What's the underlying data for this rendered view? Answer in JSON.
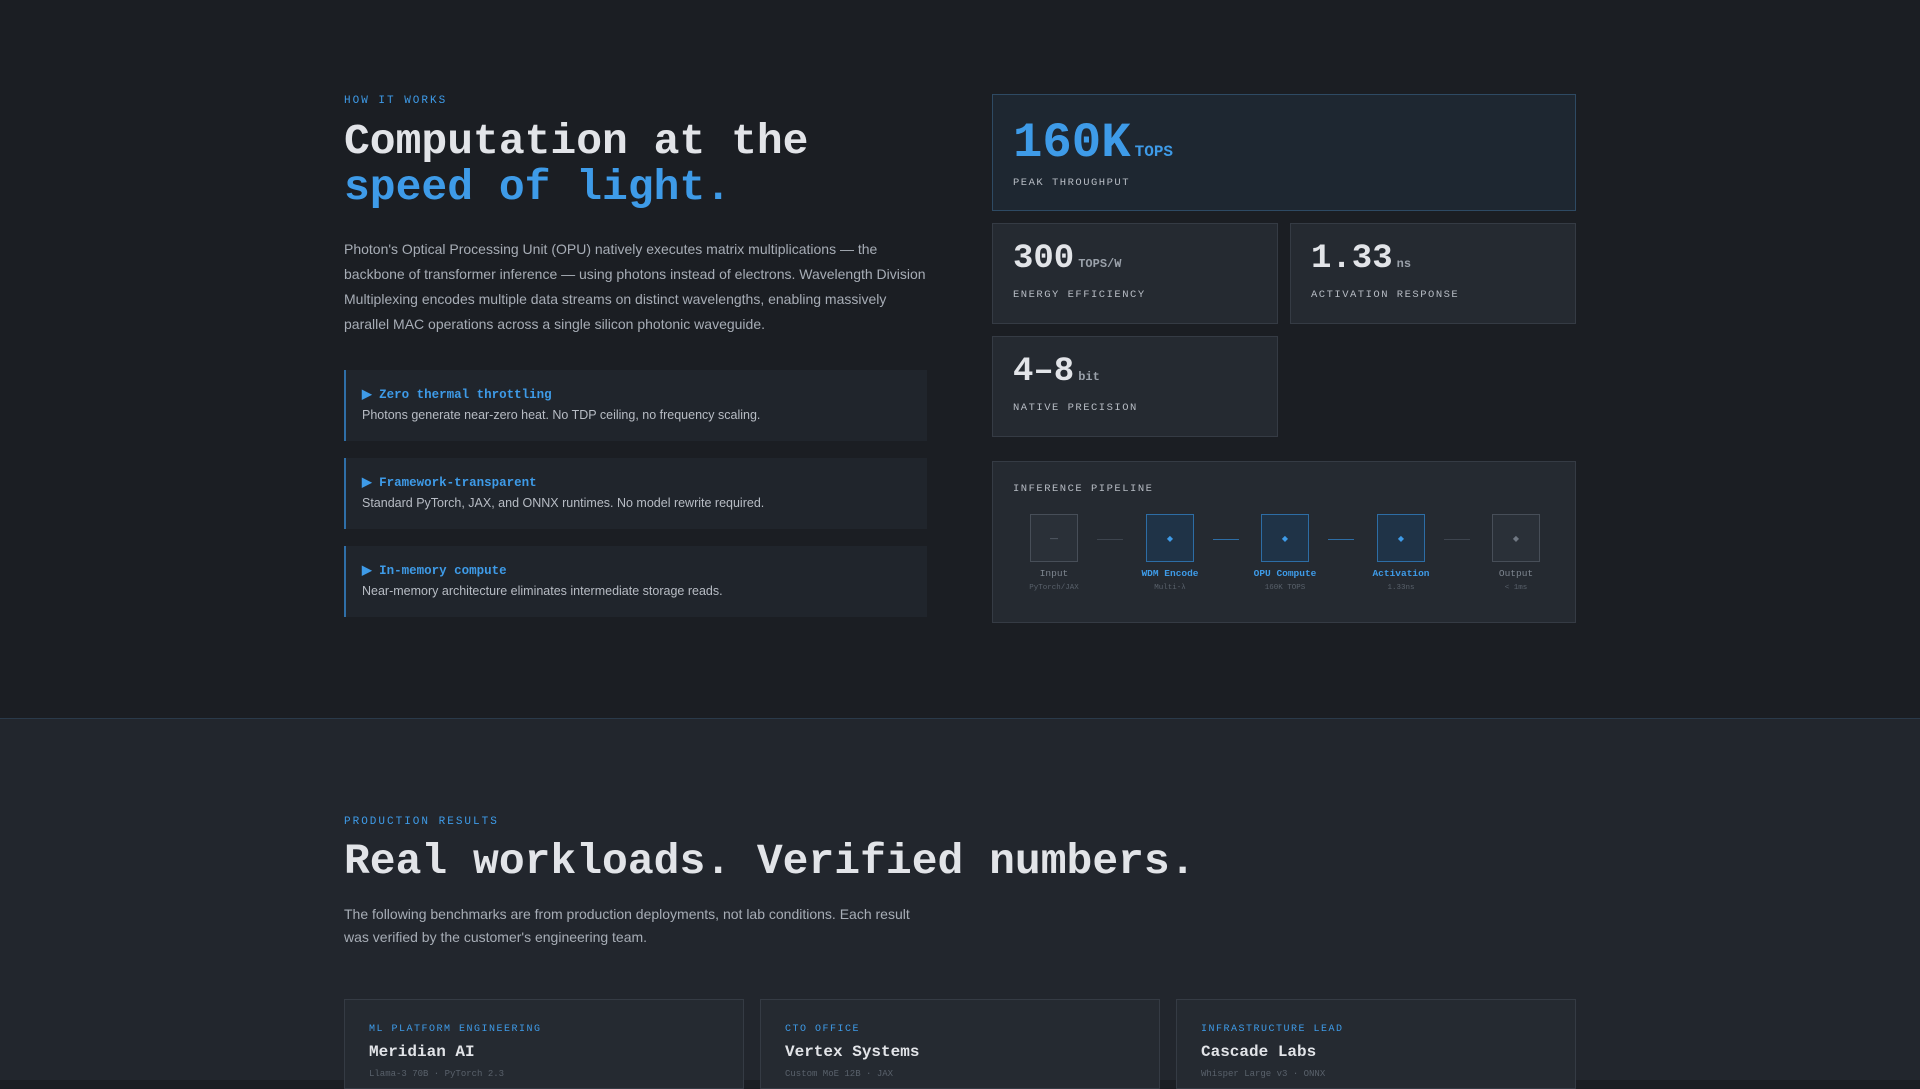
{
  "how": {
    "eyebrow": "HOW IT WORKS",
    "title_line1": "Computation at the",
    "title_line2": "speed of light.",
    "lead": "Photon's Optical Processing Unit (OPU) natively executes matrix multiplications — the backbone of transformer inference — using photons instead of electrons. Wavelength Division Multiplexing encodes multiple data streams on distinct wavelengths, enabling massively parallel MAC operations across a single silicon photonic waveguide.",
    "features": [
      {
        "title": "▶ Zero thermal throttling",
        "desc": "Photons generate near-zero heat. No TDP ceiling, no frequency scaling."
      },
      {
        "title": "▶ Framework-transparent",
        "desc": "Standard PyTorch, JAX, and ONNX runtimes. No model rewrite required."
      },
      {
        "title": "▶ In-memory compute",
        "desc": "Near-memory architecture eliminates intermediate storage reads."
      }
    ]
  },
  "stats": {
    "peak": {
      "value": "160K",
      "unit": "TOPS",
      "label": "PEAK THROUGHPUT"
    },
    "efficiency": {
      "value": "300",
      "unit": "TOPS/W",
      "label": "ENERGY EFFICIENCY"
    },
    "activation": {
      "value": "1.33",
      "unit": "ns",
      "label": "ACTIVATION RESPONSE"
    },
    "precision": {
      "value": "4–8",
      "unit": "bit",
      "label": "NATIVE PRECISION"
    }
  },
  "pipeline": {
    "title": "INFERENCE PIPELINE",
    "nodes": [
      {
        "glyph": "—",
        "label": "Input",
        "sub": "PyTorch/JAX"
      },
      {
        "glyph": "◆",
        "label": "WDM Encode",
        "sub": "Multi-λ"
      },
      {
        "glyph": "◆",
        "label": "OPU Compute",
        "sub": "160K TOPS"
      },
      {
        "glyph": "◆",
        "label": "Activation",
        "sub": "1.33ns"
      },
      {
        "glyph": "◆",
        "label": "Output",
        "sub": "< 1ms"
      }
    ]
  },
  "results": {
    "eyebrow": "PRODUCTION RESULTS",
    "title": "Real workloads. Verified numbers.",
    "lead_line1": "The following benchmarks are from production deployments, not lab conditions. Each result",
    "lead_line2": "was verified by the customer's engineering team.",
    "cards": [
      {
        "role": "ML PLATFORM ENGINEERING",
        "company": "Meridian AI",
        "meta": "Llama-3 70B · PyTorch 2.3"
      },
      {
        "role": "CTO OFFICE",
        "company": "Vertex Systems",
        "meta": "Custom MoE 12B · JAX"
      },
      {
        "role": "INFRASTRUCTURE LEAD",
        "company": "Cascade Labs",
        "meta": "Whisper Large v3 · ONNX"
      }
    ]
  },
  "colors": {
    "accent": "#3e9be8",
    "background": "#1b1e23",
    "card": "#252a31"
  }
}
